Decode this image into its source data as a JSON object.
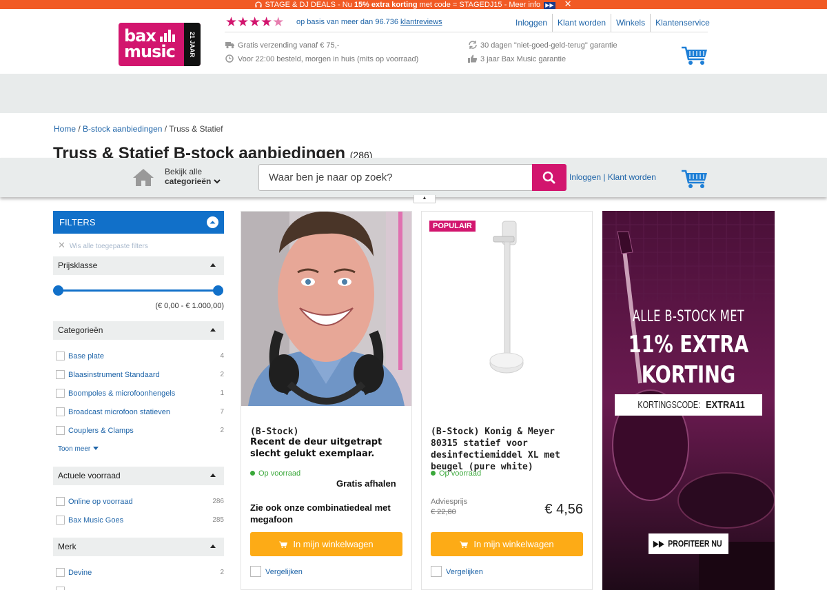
{
  "promo": {
    "text_a": "STAGE & DJ DEALS - Nu ",
    "text_bold": "15% extra korting",
    "text_b": " met code = STAGEDJ15 - Meer info",
    "badge": "▶▶",
    "close": "✕"
  },
  "header": {
    "logo_line1": "bax",
    "logo_line2": "music",
    "logo_band": "21 JAAR",
    "rating_stars": 4.5,
    "reviews_prefix": "op basis van meer dan 96.736 ",
    "reviews_link": "klantreviews",
    "links": [
      "Inloggen",
      "Klant worden",
      "Winkels",
      "Klantenservice"
    ],
    "usps": {
      "shipping": "Gratis verzending vanaf € 75,-",
      "delivery": "Voor 22:00 besteld, morgen in huis (mits op voorraad)",
      "return": "30 dagen \"niet-goed-geld-terug\" garantie",
      "warranty": "3 jaar Bax Music garantie"
    }
  },
  "breadcrumb": {
    "home": "Home",
    "sep1": " / ",
    "bstock": "B-stock aanbiedingen",
    "sep2": " / ",
    "current": "Truss & Statief"
  },
  "page": {
    "title": "Truss & Statief B-stock aanbiedingen",
    "count": "(286)"
  },
  "sticky": {
    "cat_line1": "Bekijk alle",
    "cat_line2": "categorieën",
    "search_placeholder": "Waar ben je naar op zoek?",
    "login": "Inloggen",
    "divider": " | ",
    "register": "Klant worden",
    "tab": "▲"
  },
  "filters": {
    "head": "FILTERS",
    "clear": "Wis alle toegepaste filters",
    "price_section": "Prijsklasse",
    "price_range": "(€ 0,00 - € 1.000,00)",
    "categories_section": "Categorieën",
    "categories": [
      {
        "label": "Base plate",
        "count": "4"
      },
      {
        "label": "Blaasinstrument Standaard",
        "count": "2"
      },
      {
        "label": "Boompoles & microfoonhengels",
        "count": "1"
      },
      {
        "label": "Broadcast microfoon statieven",
        "count": "7"
      },
      {
        "label": "Couplers & Clamps",
        "count": "2"
      }
    ],
    "show_more": "Toon meer",
    "stock_section": "Actuele voorraad",
    "stock": [
      {
        "label": "Online op voorraad",
        "count": "286"
      },
      {
        "label": "Bax Music Goes",
        "count": "285"
      }
    ],
    "brand_section": "Merk",
    "brands": [
      {
        "label": "Devine",
        "count": "2"
      }
    ]
  },
  "products": [
    {
      "title": "(B-Stock)",
      "overlay": "Recent de deur uitgetrapt slecht gelukt exemplaar.",
      "stock": "Op voorraad",
      "pickup": "Gratis afhalen",
      "combo": "Zie ook onze combinatiedeal met megafoon",
      "cart": "In mijn winkelwagen",
      "compare": "Vergelijken"
    },
    {
      "badge": "POPULAIR",
      "title": "(B-Stock) Konig & Meyer 80315 statief voor desinfectiemiddel XL met beugel (pure white)",
      "stock": "Op voorraad",
      "advies_label": "Adviesprijs",
      "old_price": "€ 22,80",
      "price": "€ 4,56",
      "cart": "In mijn winkelwagen",
      "compare": "Vergelijken"
    }
  ],
  "banner": {
    "line1": "ALLE B-STOCK MET",
    "line2a": "11% EXTRA",
    "line2b": "KORTING",
    "code_label": "KORTINGSCODE: ",
    "code": "EXTRA11",
    "cta": "PROFITEER NU"
  },
  "colors": {
    "brand_pink": "#d2156e",
    "promo_orange": "#f15a24",
    "filter_blue": "#1170c9",
    "cart_orange": "#fdab16",
    "link_blue": "#1e64a8"
  }
}
